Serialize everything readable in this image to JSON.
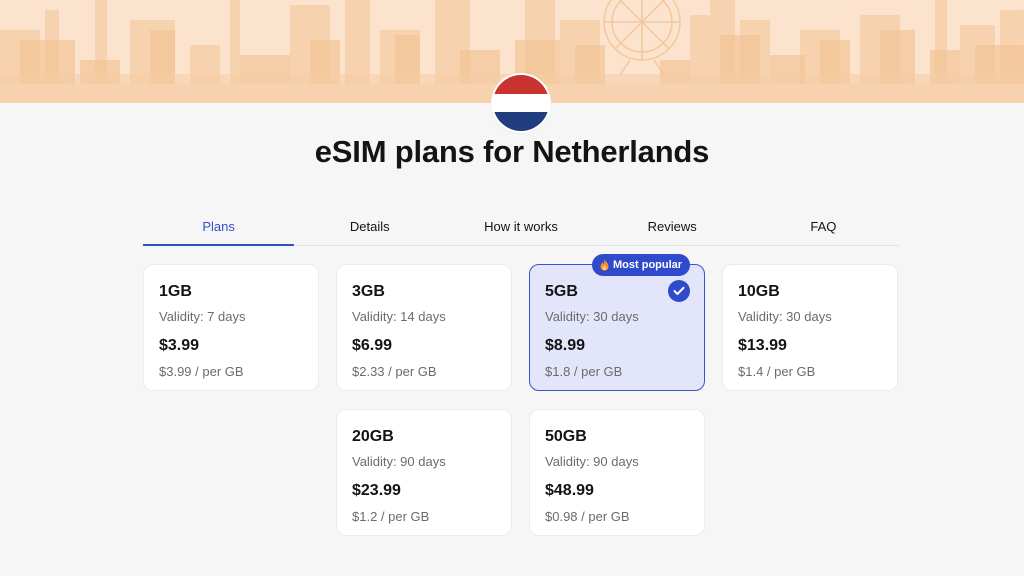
{
  "country": "Netherlands",
  "flag_colors": [
    "#c8322f",
    "#ffffff",
    "#223d7e"
  ],
  "accent_color": "#3050c8",
  "title": "eSIM plans for Netherlands",
  "tabs": [
    {
      "label": "Plans",
      "active": true
    },
    {
      "label": "Details",
      "active": false
    },
    {
      "label": "How it works",
      "active": false
    },
    {
      "label": "Reviews",
      "active": false
    },
    {
      "label": "FAQ",
      "active": false
    }
  ],
  "plans": [
    {
      "data": "1GB",
      "validity": "Validity: 7 days",
      "price": "$3.99",
      "per_gb": "$3.99 / per GB",
      "selected": false
    },
    {
      "data": "3GB",
      "validity": "Validity: 14 days",
      "price": "$6.99",
      "per_gb": "$2.33 / per GB",
      "selected": false
    },
    {
      "data": "5GB",
      "validity": "Validity: 30 days",
      "price": "$8.99",
      "per_gb": "$1.8 / per GB",
      "selected": true,
      "badge": "Most popular",
      "badge_icon": "fire-icon"
    },
    {
      "data": "10GB",
      "validity": "Validity: 30 days",
      "price": "$13.99",
      "per_gb": "$1.4 / per GB",
      "selected": false
    },
    {
      "data": "20GB",
      "validity": "Validity: 90 days",
      "price": "$23.99",
      "per_gb": "$1.2 / per GB",
      "selected": false
    },
    {
      "data": "50GB",
      "validity": "Validity: 90 days",
      "price": "$48.99",
      "per_gb": "$0.98 / per GB",
      "selected": false
    }
  ]
}
